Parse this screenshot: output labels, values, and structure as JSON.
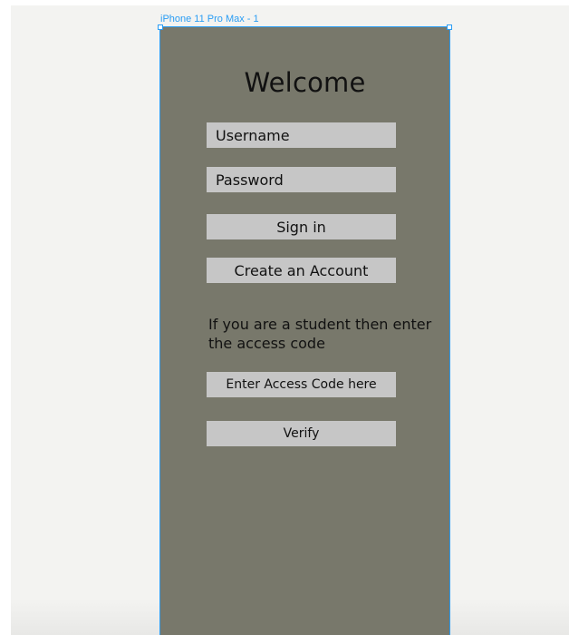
{
  "frame": {
    "label": "iPhone 11 Pro Max - 1",
    "background": "#78786b",
    "selection_color": "#2a9df4"
  },
  "login": {
    "title": "Welcome",
    "username_placeholder": "Username",
    "password_placeholder": "Password",
    "signin_label": "Sign in",
    "create_account_label": "Create an Account"
  },
  "student": {
    "info_text": "If you are a student then enter the access code",
    "access_code_placeholder": "Enter Access Code here",
    "verify_label": "Verify"
  }
}
